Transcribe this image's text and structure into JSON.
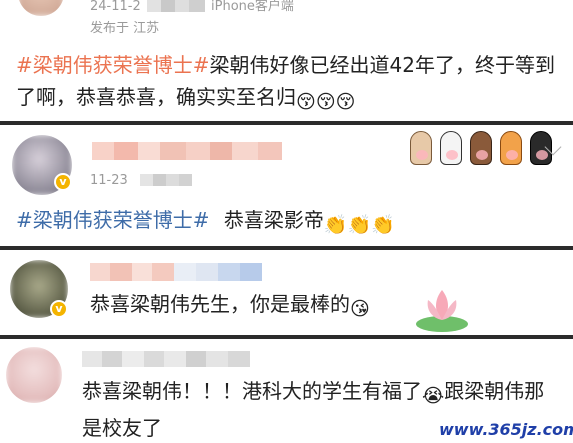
{
  "post1": {
    "timestamp": "24-11-2",
    "client": "iPhone客户端",
    "location_label": "发布于",
    "location": "江苏",
    "hashtag": "#梁朝伟获荣誉博士#",
    "text": "梁朝伟好像已经出道42年了，终于等到了啊，恭喜恭喜，确实实至名归",
    "emojis": [
      "😚",
      "😚",
      "😚"
    ]
  },
  "post2": {
    "timestamp": "11-23",
    "hashtag": "#梁朝伟获荣誉博士#",
    "text": "恭喜梁影帝",
    "emojis": [
      "👏",
      "👏",
      "👏"
    ],
    "verified_badge": "v",
    "sticker_icon": "cat-paws-sticker"
  },
  "comment1": {
    "text": "恭喜梁朝伟先生，你是最棒的",
    "emoji": "😘",
    "verified_badge": "v",
    "sticker_icon": "lotus-sticker"
  },
  "comment2": {
    "text": "恭喜梁朝伟！！！港科大的学生有福了",
    "emoji": "😭",
    "text2": "跟梁朝伟那是校友了"
  },
  "watermark": "www.365jz.com",
  "colors": {
    "hashtag_orange": "#eb7350",
    "hashtag_blue": "#3e6ca8",
    "separator": "#2b2b2b",
    "verified": "#f4b400"
  }
}
